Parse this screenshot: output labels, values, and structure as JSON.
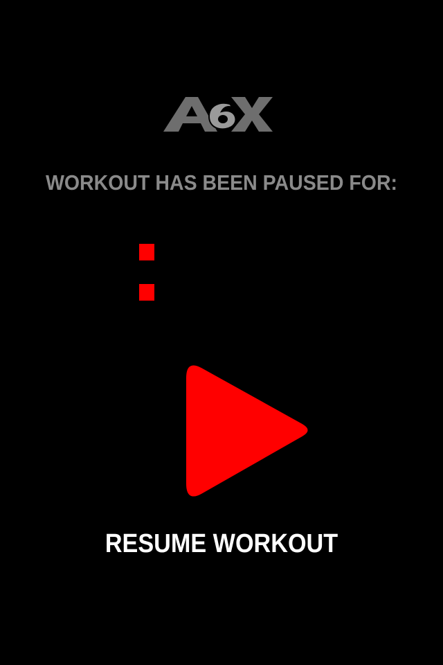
{
  "app": {
    "logo_text": "A6X"
  },
  "pause_screen": {
    "paused_label": "WORKOUT HAS BEEN PAUSED FOR:",
    "resume_label": "RESUME WORKOUT"
  },
  "colors": {
    "background": "#000000",
    "accent": "#ff0000",
    "label_gray": "#8a8a8a",
    "resume_text": "#ffffff",
    "logo_gray": "#6e6e6e"
  },
  "icons": {
    "play": "play-icon",
    "timer_separator": "colon-icon"
  }
}
